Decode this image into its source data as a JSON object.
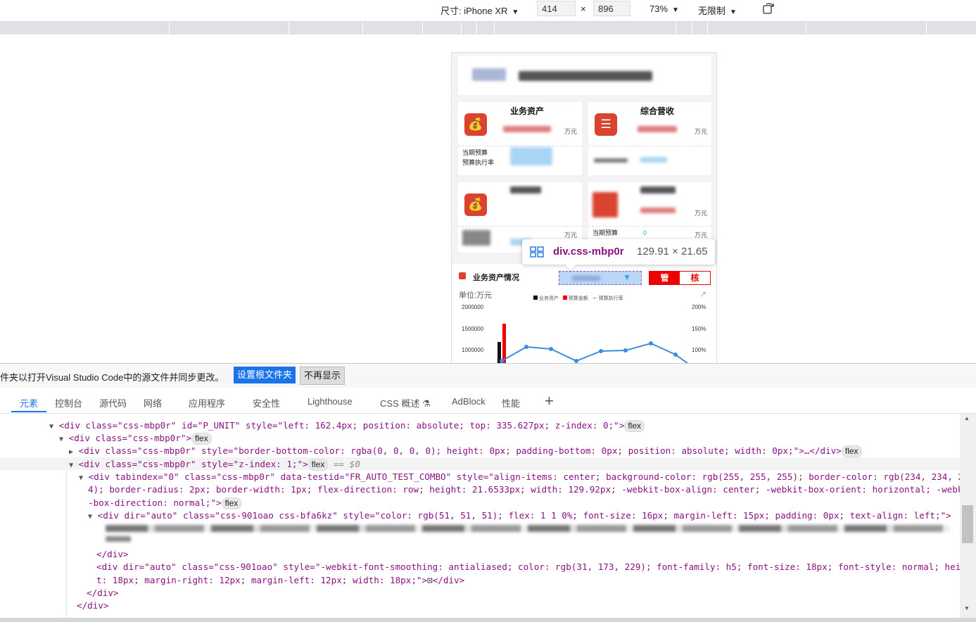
{
  "device_toolbar": {
    "dimensions_label": "尺寸: iPhone XR",
    "width": "414",
    "times": "×",
    "height": "896",
    "zoom": "73%",
    "throttle": "无限制"
  },
  "phone": {
    "card1_title": "业务资产",
    "card1_unit": "万元",
    "card1_row1": "当期预算",
    "card1_row2": "预算执行率",
    "card2_title": "综合营收",
    "card2_unit": "万元",
    "card3_unit": "万元",
    "card4_unit_a": "万元",
    "card4_unit_b": "万元",
    "card4_row1": "当期预算",
    "card4_zero": "0",
    "section_title": "业务资产情况",
    "toggle_left": "管",
    "toggle_right": "核",
    "unit_label": "单位:万元",
    "legend": [
      "业务资产",
      "预算金额",
      "预算执行率"
    ],
    "y_left": [
      "2000000",
      "1500000",
      "1000000"
    ],
    "y_right": [
      "200%",
      "150%",
      "100%"
    ]
  },
  "tooltip": {
    "selector": "div.css-mbp0r",
    "size": "129.91 × 21.65"
  },
  "notify": {
    "message": "件夹以打开Visual Studio Code中的源文件并同步更改。",
    "primary": "设置根文件夹",
    "secondary": "不再显示"
  },
  "devtools_tabs": [
    "元素",
    "控制台",
    "源代码",
    "网络",
    "应用程序",
    "安全性",
    "Lighthouse",
    "CSS 概述",
    "AdBlock",
    "性能"
  ],
  "code": {
    "l1_tag": "<div class=\"css-mbp0r\" id=\"P_UNIT\" style=\"left: 162.4px; position: absolute; top: 335.627px; z-index: 0;\">",
    "l2_tag": "<div class=\"css-mbp0r\">",
    "l3_tag": "<div class=\"css-mbp0r\" style=\"border-bottom-color: rgba(0, 0, 0, 0); height: 0px; padding-bottom: 0px; position: absolute; width: 0px;\">…</div>",
    "l4_tag": "<div class=\"css-mbp0r\" style=\"z-index: 1;\">",
    "l4_eq": "== $0",
    "l5": "<div tabindex=\"0\" class=\"css-mbp0r\" data-testid=\"FR_AUTO_TEST_COMBO\" style=\"align-items: center; background-color: rgb(255, 255, 255); border-color: rgb(234, 234, 23",
    "l6": "4); border-radius: 2px; border-width: 1px; flex-direction: row; height: 21.6533px; width: 129.92px; -webkit-box-align: center; -webkit-box-orient: horizontal; -webkit",
    "l7": "-box-direction: normal;\">",
    "l8": "<div dir=\"auto\" class=\"css-901oao css-bfa6kz\" style=\"color: rgb(51, 51, 51); flex: 1 1 0%; font-size: 16px; margin-left: 15px; padding: 0px; text-align: left;\">",
    "l11": "</div>",
    "l12": "<div dir=\"auto\" class=\"css-901oao\" style=\"-webkit-font-smoothing: antialiased; color: rgb(31, 173, 229); font-family: h5; font-size: 18px; font-style: normal; heigh",
    "l13": "t: 18px; margin-right: 12px; margin-left: 12px; width: 18px;\">",
    "l13b": "</div>",
    "l14": "</div>",
    "l15": "</div>",
    "flex": "flex"
  }
}
